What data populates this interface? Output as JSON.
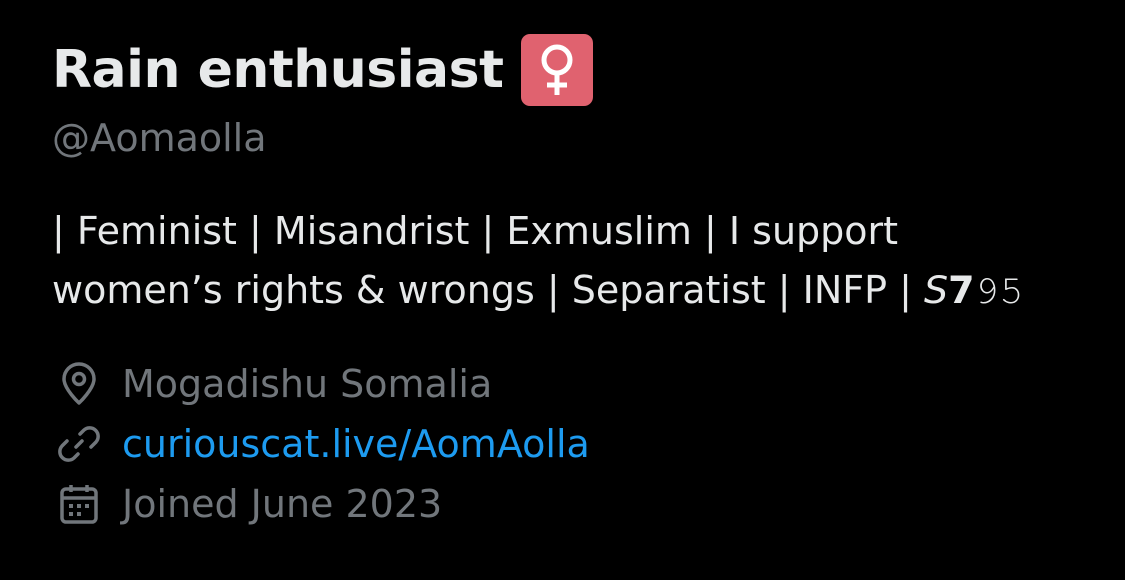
{
  "profile": {
    "display_name": "Rain enthusiast",
    "badge_icon": "female-sign-icon",
    "badge_color": "#e0626f",
    "handle": "@Aomaolla",
    "bio": {
      "line1": "| Feminist | Misandrist | Exmuslim | I support",
      "line2": "women’s rights & wrongs | Separatist | INFP | 𝘚𝟳𝟿𝟻"
    },
    "location": {
      "icon": "location-pin-icon",
      "text": "Mogadishu Somalia"
    },
    "website": {
      "icon": "link-icon",
      "text": "curiouscat.live/AomAolla"
    },
    "joined": {
      "icon": "calendar-icon",
      "text": "Joined June 2023"
    }
  },
  "colors": {
    "background": "#000000",
    "primary_text": "#e7e9ea",
    "secondary_text": "#71767b",
    "link": "#1d9bf0"
  }
}
